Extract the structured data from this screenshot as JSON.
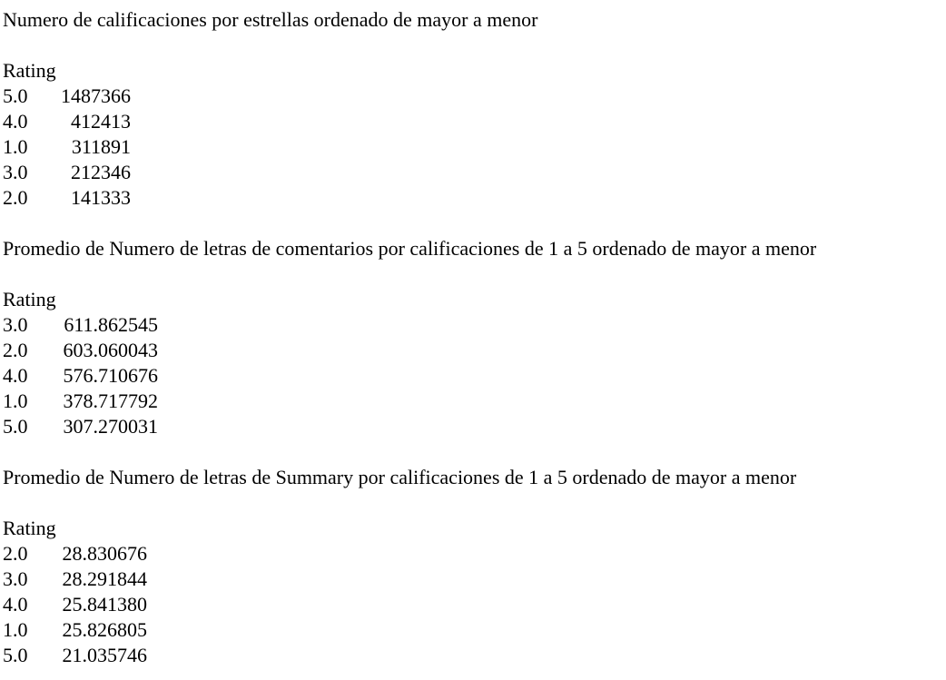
{
  "sections": [
    {
      "title": "Numero de calificaciones por estrellas ordenado de mayor a menor",
      "index_name": "Rating",
      "rows": [
        {
          "rating": "5.0",
          "value": "1487366"
        },
        {
          "rating": "4.0",
          "value": "412413"
        },
        {
          "rating": "1.0",
          "value": "311891"
        },
        {
          "rating": "3.0",
          "value": "212346"
        },
        {
          "rating": "2.0",
          "value": "141333"
        }
      ]
    },
    {
      "title": "Promedio de Numero de letras de comentarios por calificaciones de 1 a 5 ordenado de mayor a menor",
      "index_name": "Rating",
      "rows": [
        {
          "rating": "3.0",
          "value": "611.862545"
        },
        {
          "rating": "2.0",
          "value": "603.060043"
        },
        {
          "rating": "4.0",
          "value": "576.710676"
        },
        {
          "rating": "1.0",
          "value": "378.717792"
        },
        {
          "rating": "5.0",
          "value": "307.270031"
        }
      ]
    },
    {
      "title": "Promedio de Numero de letras de Summary por calificaciones de 1 a 5 ordenado de mayor a menor",
      "index_name": "Rating",
      "rows": [
        {
          "rating": "2.0",
          "value": "28.830676"
        },
        {
          "rating": "3.0",
          "value": "28.291844"
        },
        {
          "rating": "4.0",
          "value": "25.841380"
        },
        {
          "rating": "1.0",
          "value": "25.826805"
        },
        {
          "rating": "5.0",
          "value": "21.035746"
        }
      ]
    }
  ]
}
